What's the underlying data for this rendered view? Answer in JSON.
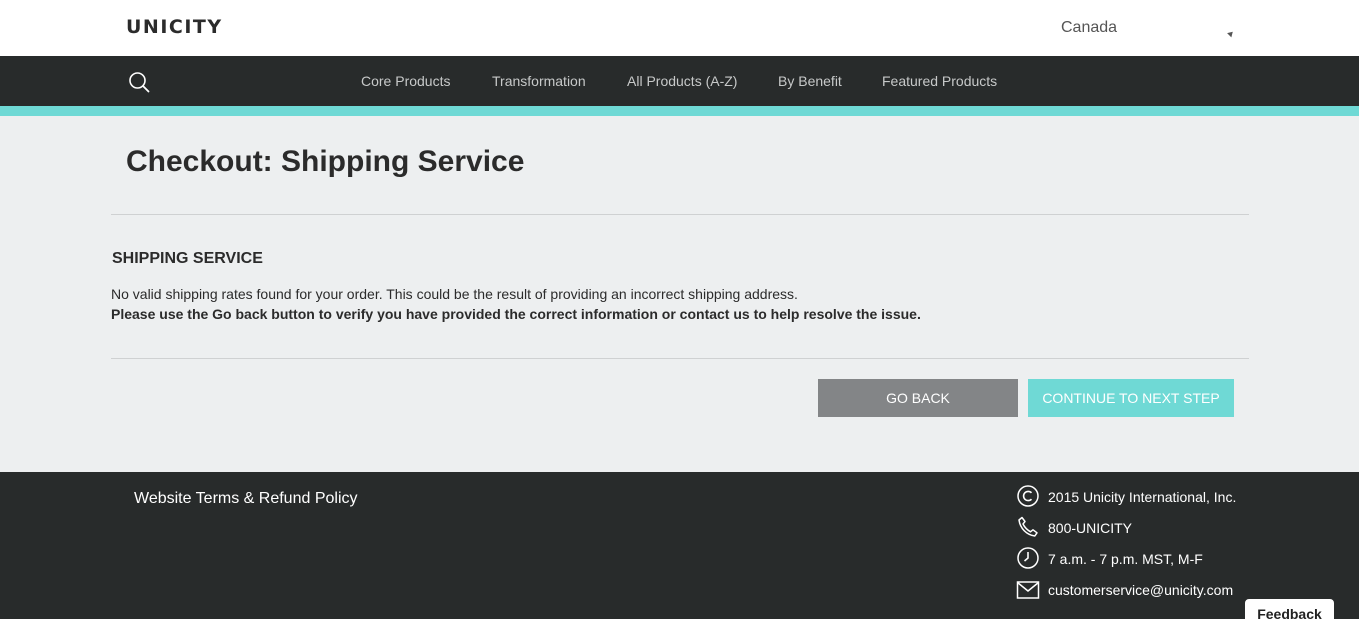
{
  "header": {
    "logo": "UNICITY",
    "country": "Canada"
  },
  "nav": {
    "items": [
      {
        "label": "Core Products"
      },
      {
        "label": "Transformation"
      },
      {
        "label": "All Products (A-Z)"
      },
      {
        "label": "By Benefit"
      },
      {
        "label": "Featured Products"
      }
    ]
  },
  "main": {
    "title": "Checkout: Shipping Service",
    "section_title": "SHIPPING SERVICE",
    "message": "No valid shipping rates found for your order. This could be the result of providing an incorrect shipping address.",
    "message_bold": "Please use the Go back button to verify you have provided the correct information or contact us to help resolve the issue.",
    "go_back_label": "GO BACK",
    "continue_label": "CONTINUE TO NEXT STEP"
  },
  "footer": {
    "terms_link": "Website Terms & Refund Policy",
    "copyright": "2015 Unicity International, Inc.",
    "phone": "800-UNICITY",
    "hours": "7 a.m. - 7 p.m. MST, M-F",
    "email": "customerservice@unicity.com"
  },
  "feedback_label": "Feedback",
  "colors": {
    "accent": "#6fd9d5",
    "dark": "#282b2b",
    "button_gray": "#838587",
    "background": "#edeff0"
  },
  "icons": [
    "search-icon",
    "dropdown-caret-icon",
    "copyright-icon",
    "phone-icon",
    "clock-icon",
    "mail-icon"
  ]
}
